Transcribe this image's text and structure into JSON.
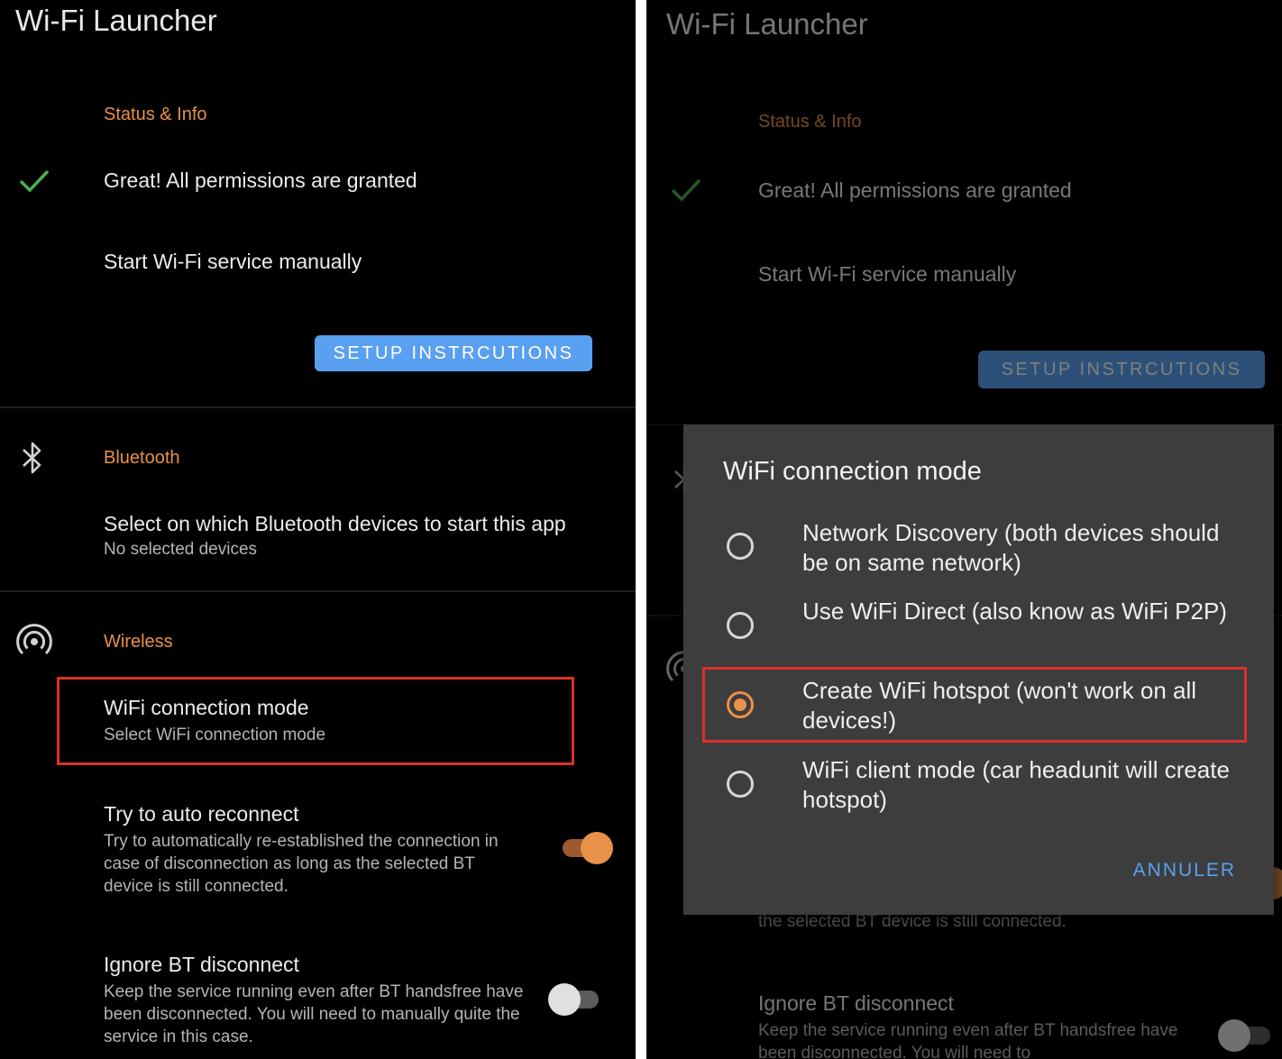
{
  "app": {
    "title": "Wi-Fi Launcher"
  },
  "status": {
    "header": "Status & Info",
    "permissions": "Great! All permissions are granted",
    "start_manually": "Start Wi-Fi service manually",
    "setup_button": "SETUP INSTRCUTIONS"
  },
  "bluetooth": {
    "header": "Bluetooth",
    "select_title": "Select on which Bluetooth devices to start this app",
    "select_summary": "No selected devices"
  },
  "wireless": {
    "header": "Wireless",
    "mode_title": "WiFi connection mode",
    "mode_summary": "Select WiFi connection mode",
    "auto_title": "Try to auto reconnect",
    "auto_summary": "Try to automatically re-established the connection in case of disconnection as long as the selected BT device is still connected.",
    "auto_enabled": true,
    "ignore_title": "Ignore BT disconnect",
    "ignore_summary": "Keep the service running even after BT handsfree have been disconnected. You will need to manually quite the service in this case.",
    "ignore_enabled": false
  },
  "right_background": {
    "auto_summary_fragment": "the selected BT device is still connected.",
    "ignore_summary_fragment": "Keep the service running even after BT handsfree have been disconnected. You will need to"
  },
  "dialog": {
    "title": "WiFi connection mode",
    "options": [
      {
        "label": "Network Discovery (both devices should be on same network)",
        "selected": false
      },
      {
        "label": "Use WiFi Direct (also know as WiFi P2P)",
        "selected": false
      },
      {
        "label": "Create WiFi hotspot (won't work on all devices!)",
        "selected": true
      },
      {
        "label": "WiFi client mode (car headunit will create hotspot)",
        "selected": false
      }
    ],
    "cancel": "ANNULER"
  },
  "colors": {
    "accent": "#e8914a",
    "button": "#5aa0f0",
    "check": "#4caf50",
    "highlight": "#d9312b",
    "dialog_bg": "#3d3d3d"
  },
  "icons": [
    "check-icon",
    "bluetooth-icon",
    "wireless-icon"
  ]
}
